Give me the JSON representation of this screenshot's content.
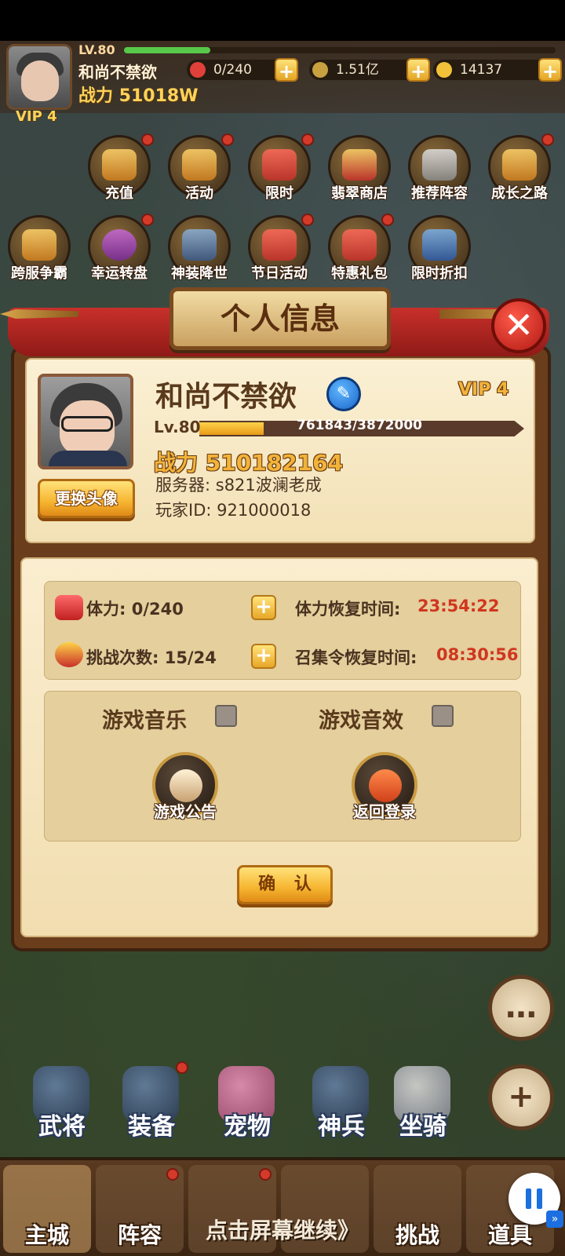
{
  "topbar": {
    "level": "LV.80",
    "player_name": "和尚不禁欲",
    "power": "战力 51018W",
    "vip": "VIP 4",
    "resources": [
      {
        "name": "stamina",
        "value": "0/240",
        "icon": "heart-icon",
        "color": "#e0403a"
      },
      {
        "name": "coins",
        "value": "1.51亿",
        "icon": "coin-icon",
        "color": "#c8a040"
      },
      {
        "name": "gold",
        "value": "14137",
        "icon": "gold-ingot-icon",
        "color": "#f2c13a"
      }
    ]
  },
  "menu": {
    "row1": [
      {
        "label": "充值",
        "dot": true
      },
      {
        "label": "活动",
        "dot": true
      },
      {
        "label": "限时",
        "dot": true
      },
      {
        "label": "翡翠商店",
        "dot": false
      },
      {
        "label": "推荐阵容",
        "dot": false
      },
      {
        "label": "成长之路",
        "dot": true
      }
    ],
    "row2": [
      {
        "label": "跨服争霸",
        "dot": false
      },
      {
        "label": "幸运转盘",
        "dot": true
      },
      {
        "label": "神装降世",
        "dot": false
      },
      {
        "label": "节日活动",
        "dot": true
      },
      {
        "label": "特惠礼包",
        "dot": true
      },
      {
        "label": "限时折扣",
        "dot": false
      }
    ]
  },
  "modal": {
    "title": "个人信息",
    "player_name": "和尚不禁欲",
    "vip": "VIP 4",
    "level_label": "Lv.80",
    "exp_text": "761843/3872000",
    "exp_progress": 0.197,
    "power": "战力 510182164",
    "server": "服务器:  s821波澜老成",
    "player_id": "玩家ID:  921000018",
    "change_avatar": "更换头像",
    "stamina": "体力:  0/240",
    "stamina_recover_label": "体力恢复时间:",
    "stamina_recover_time": "23:54:22",
    "challenge": "挑战次数:  15/24",
    "summon_recover_label": "召集令恢复时间:",
    "summon_recover_time": "08:30:56",
    "music_label": "游戏音乐",
    "music_checked": false,
    "sfx_label": "游戏音效",
    "sfx_checked": false,
    "notice_label": "游戏公告",
    "logout_label": "返回登录",
    "confirm_label": "确 认"
  },
  "features": [
    {
      "label": "武将",
      "dot": false
    },
    {
      "label": "装备",
      "dot": true
    },
    {
      "label": "宠物",
      "dot": false
    },
    {
      "label": "神兵",
      "dot": false
    },
    {
      "label": "坐骑",
      "dot": false
    }
  ],
  "tabs": [
    {
      "label": "主城",
      "dot": false
    },
    {
      "label": "阵容",
      "dot": true
    },
    {
      "label": "",
      "dot": true
    },
    {
      "label": "",
      "dot": false
    },
    {
      "label": "挑战",
      "dot": false
    },
    {
      "label": "道具",
      "dot": false
    }
  ],
  "continue_hint": "点击屏幕继续》"
}
